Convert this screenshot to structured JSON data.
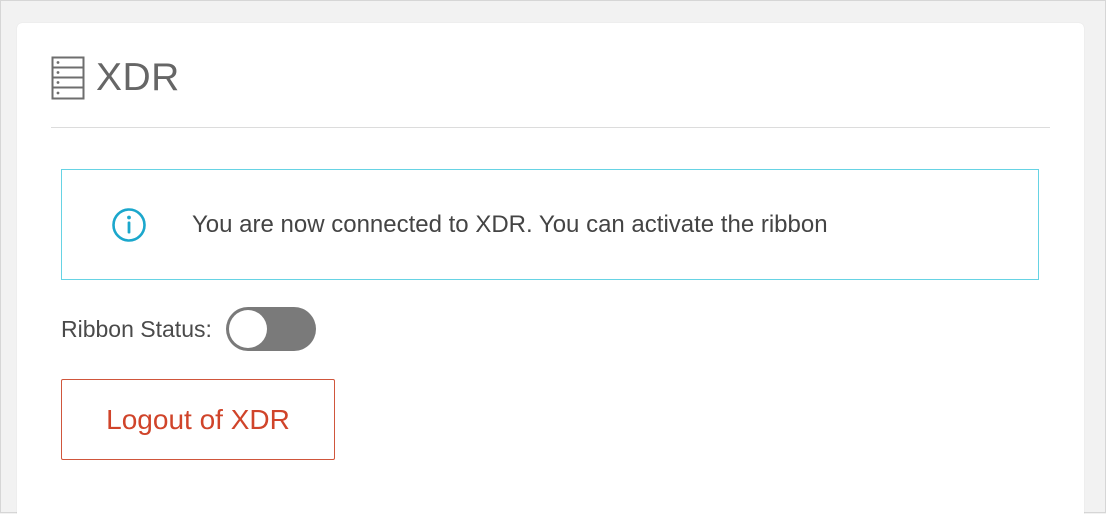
{
  "panel": {
    "title": "XDR",
    "header_icon": "server-icon"
  },
  "info": {
    "icon": "info-icon",
    "message": "You are now connected to XDR. You can activate the ribbon",
    "accent_color": "#1ba7cc"
  },
  "ribbon": {
    "label": "Ribbon Status:",
    "enabled": false
  },
  "actions": {
    "logout_label": "Logout of XDR",
    "logout_color": "#d0442a"
  }
}
